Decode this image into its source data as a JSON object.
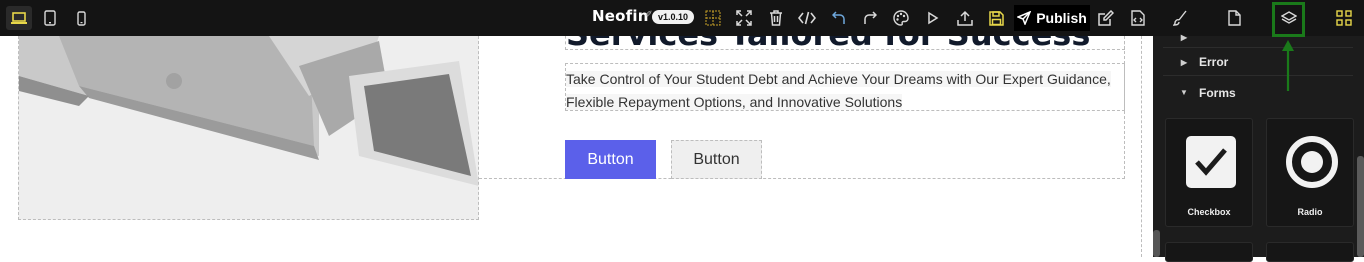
{
  "toolbar": {
    "devices": [
      {
        "name": "desktop-icon",
        "active": true
      },
      {
        "name": "tablet-icon",
        "active": false
      },
      {
        "name": "mobile-icon",
        "active": false
      }
    ],
    "brand": "Neofin",
    "brand_mark": "✐",
    "version": "v1.0.10",
    "actions": [
      "grid-icon",
      "fullscreen-icon",
      "trash-icon",
      "code-icon",
      "undo-icon",
      "redo-icon",
      "palette-icon",
      "play-icon",
      "upload-icon",
      "save-icon"
    ],
    "publish_label": "Publish",
    "right_actions": [
      "edit-icon",
      "export-icon",
      "brush-icon",
      "page-icon",
      "layers-icon",
      "blocks-icon"
    ]
  },
  "canvas": {
    "heading": "Services Tailored for Success",
    "paragraph": "Take Control of Your Student Debt and Achieve Your Dreams with Our Expert Guidance, Flexible Repayment Options, and Innovative Solutions",
    "primary_button": "Button",
    "secondary_button": "Button"
  },
  "panel": {
    "categories": [
      {
        "label": "Error",
        "expanded": false
      },
      {
        "label": "Forms",
        "expanded": true
      }
    ],
    "blocks": [
      {
        "label": "Checkbox",
        "icon": "checkbox-icon"
      },
      {
        "label": "Radio",
        "icon": "radio-icon"
      }
    ]
  },
  "colors": {
    "toolbar_bg": "#141414",
    "panel_bg": "#1c1c1c",
    "primary_button": "#5b60ea",
    "highlight": "#1a7a1a",
    "save_icon": "#e8d84a",
    "undo_icon": "#6fa8dc"
  }
}
